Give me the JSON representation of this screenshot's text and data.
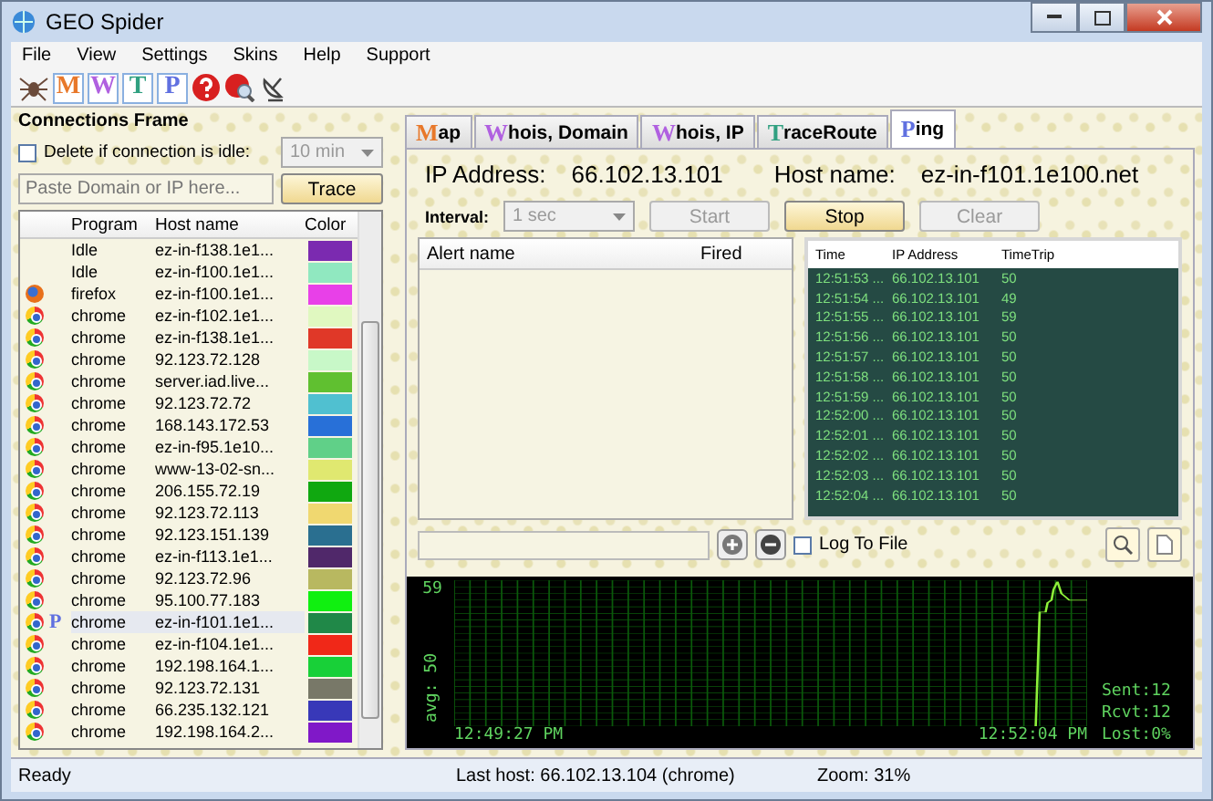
{
  "window": {
    "title": "GEO Spider"
  },
  "menu": [
    "File",
    "View",
    "Settings",
    "Skins",
    "Help",
    "Support"
  ],
  "toolbar_letters": [
    {
      "letter": "M",
      "color": "#e8782a"
    },
    {
      "letter": "W",
      "color": "#b060e0"
    },
    {
      "letter": "T",
      "color": "#30a080"
    },
    {
      "letter": "P",
      "color": "#6070e0"
    }
  ],
  "connections": {
    "title": "Connections Frame",
    "idle_checkbox": {
      "label": "Delete if connection is idle:",
      "checked": false
    },
    "idle_select": {
      "value": "10 min",
      "disabled": true
    },
    "domain_field": {
      "placeholder": "Paste Domain or IP here..."
    },
    "trace_button": "Trace",
    "ping_marker": "P",
    "columns": [
      "Program",
      "Host name",
      "Color"
    ],
    "rows": [
      {
        "kind": "none",
        "program": "Idle",
        "host": "ez-in-f138.1e1...",
        "color": "#7b2ab0",
        "selected": false
      },
      {
        "kind": "none",
        "program": "Idle",
        "host": "ez-in-f100.1e1...",
        "color": "#90e8c0",
        "selected": false
      },
      {
        "kind": "firefox",
        "program": "firefox",
        "host": "ez-in-f100.1e1...",
        "color": "#e840e8",
        "selected": false
      },
      {
        "kind": "chrome",
        "program": "chrome",
        "host": "ez-in-f102.1e1...",
        "color": "#e0f8c0",
        "selected": false
      },
      {
        "kind": "chrome",
        "program": "chrome",
        "host": "ez-in-f138.1e1...",
        "color": "#e03828",
        "selected": false
      },
      {
        "kind": "chrome",
        "program": "chrome",
        "host": "92.123.72.128",
        "color": "#c8f8c8",
        "selected": false
      },
      {
        "kind": "chrome",
        "program": "chrome",
        "host": "server.iad.live...",
        "color": "#60c030",
        "selected": false
      },
      {
        "kind": "chrome",
        "program": "chrome",
        "host": "92.123.72.72",
        "color": "#50c0d0",
        "selected": false
      },
      {
        "kind": "chrome",
        "program": "chrome",
        "host": "168.143.172.53",
        "color": "#2870d8",
        "selected": false
      },
      {
        "kind": "chrome",
        "program": "chrome",
        "host": "ez-in-f95.1e10...",
        "color": "#60d088",
        "selected": false
      },
      {
        "kind": "chrome",
        "program": "chrome",
        "host": "www-13-02-sn...",
        "color": "#e0e870",
        "selected": false
      },
      {
        "kind": "chrome",
        "program": "chrome",
        "host": "206.155.72.19",
        "color": "#10a810",
        "selected": false
      },
      {
        "kind": "chrome",
        "program": "chrome",
        "host": "92.123.72.113",
        "color": "#f0d870",
        "selected": false
      },
      {
        "kind": "chrome",
        "program": "chrome",
        "host": "92.123.151.139",
        "color": "#2a6f90",
        "selected": false
      },
      {
        "kind": "chrome",
        "program": "chrome",
        "host": "ez-in-f113.1e1...",
        "color": "#50286a",
        "selected": false
      },
      {
        "kind": "chrome",
        "program": "chrome",
        "host": "92.123.72.96",
        "color": "#b8b860",
        "selected": false
      },
      {
        "kind": "chrome",
        "program": "chrome",
        "host": "95.100.77.183",
        "color": "#10f010",
        "selected": false
      },
      {
        "kind": "chrome",
        "program": "chrome",
        "host": "ez-in-f101.1e1...",
        "color": "#208848",
        "selected": true
      },
      {
        "kind": "chrome",
        "program": "chrome",
        "host": "ez-in-f104.1e1...",
        "color": "#f02818",
        "selected": false
      },
      {
        "kind": "chrome",
        "program": "chrome",
        "host": "192.198.164.1...",
        "color": "#18d038",
        "selected": false
      },
      {
        "kind": "chrome",
        "program": "chrome",
        "host": "92.123.72.131",
        "color": "#787868",
        "selected": false
      },
      {
        "kind": "chrome",
        "program": "chrome",
        "host": "66.235.132.121",
        "color": "#3838b8",
        "selected": false
      },
      {
        "kind": "chrome",
        "program": "chrome",
        "host": "192.198.164.2...",
        "color": "#8018c8",
        "selected": false
      }
    ]
  },
  "tabs": [
    {
      "letter": "M",
      "label": "ap",
      "color": "#e8782a",
      "selected": false
    },
    {
      "letter": "W",
      "label": "hois, Domain",
      "color": "#b060e0",
      "selected": false
    },
    {
      "letter": "W",
      "label": "hois, IP",
      "color": "#b060e0",
      "selected": false
    },
    {
      "letter": "T",
      "label": "raceRoute",
      "color": "#30a080",
      "selected": false
    },
    {
      "letter": "P",
      "label": "ing",
      "color": "#6070e0",
      "selected": true
    }
  ],
  "ping": {
    "ip_label": "IP Address:",
    "ip": "66.102.13.101",
    "host_label": "Host name:",
    "host": "ez-in-f101.1e100.net",
    "interval_label": "Interval:",
    "interval": {
      "value": "1 sec",
      "disabled": true
    },
    "buttons": [
      {
        "label": "Start",
        "disabled": true
      },
      {
        "label": "Stop",
        "disabled": false
      },
      {
        "label": "Clear",
        "disabled": true
      }
    ],
    "alert_columns": [
      "Alert name",
      "Fired"
    ],
    "result_columns": [
      "Time",
      "IP Address",
      "TimeTrip"
    ],
    "results": [
      [
        "12:51:53 ...",
        "66.102.13.101",
        "50"
      ],
      [
        "12:51:54 ...",
        "66.102.13.101",
        "49"
      ],
      [
        "12:51:55 ...",
        "66.102.13.101",
        "59"
      ],
      [
        "12:51:56 ...",
        "66.102.13.101",
        "50"
      ],
      [
        "12:51:57 ...",
        "66.102.13.101",
        "50"
      ],
      [
        "12:51:58 ...",
        "66.102.13.101",
        "50"
      ],
      [
        "12:51:59 ...",
        "66.102.13.101",
        "50"
      ],
      [
        "12:52:00 ...",
        "66.102.13.101",
        "50"
      ],
      [
        "12:52:01 ...",
        "66.102.13.101",
        "50"
      ],
      [
        "12:52:02 ...",
        "66.102.13.101",
        "50"
      ],
      [
        "12:52:03 ...",
        "66.102.13.101",
        "50"
      ],
      [
        "12:52:04 ...",
        "66.102.13.101",
        "50"
      ]
    ],
    "log_checkbox": {
      "label": "Log To File",
      "checked": false
    },
    "graph": {
      "max_label": "59",
      "avg_label": "avg: 50",
      "start_time": "12:49:27 PM",
      "end_time": "12:52:04 PM",
      "stats": [
        "Sent:12",
        "Rcvt:12",
        "Lost:0%"
      ]
    }
  },
  "status_bar": [
    "Ready",
    "Last host: 66.102.13.104 (chrome)",
    "Zoom: 31%"
  ]
}
